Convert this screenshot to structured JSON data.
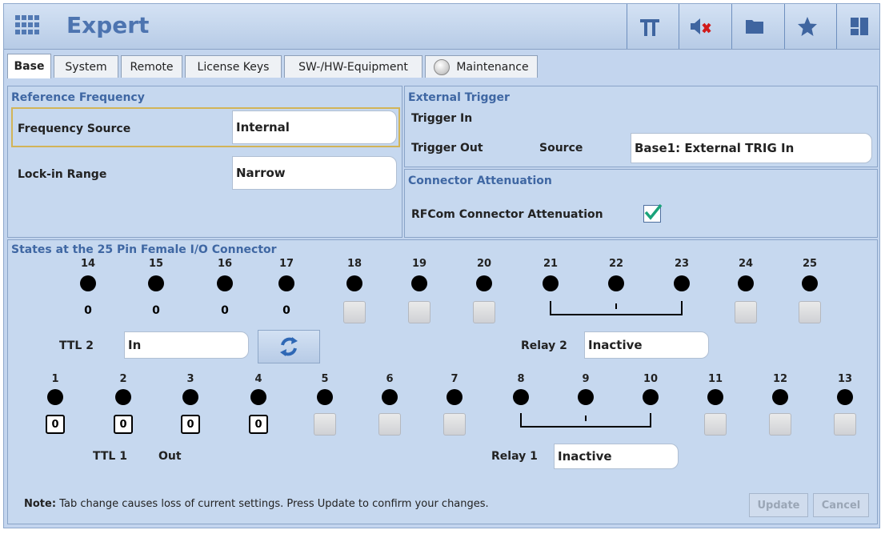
{
  "header": {
    "title": "Expert",
    "icons": [
      "apps-grid-icon",
      "pi-icon",
      "mute-icon",
      "folder-icon",
      "star-icon",
      "layout-icon"
    ]
  },
  "tabs": [
    {
      "label": "Base",
      "active": true
    },
    {
      "label": "System"
    },
    {
      "label": "Remote"
    },
    {
      "label": "License Keys"
    },
    {
      "label": "SW-/HW-Equipment"
    },
    {
      "label": "Maintenance",
      "icon": "status-led-icon"
    }
  ],
  "reference": {
    "title": "Reference Frequency",
    "freq_source_label": "Frequency Source",
    "freq_source_value": "Internal",
    "lockin_label": "Lock-in Range",
    "lockin_value": "Narrow"
  },
  "trigger": {
    "title": "External Trigger",
    "trigger_in_label": "Trigger In",
    "trigger_out_label": "Trigger Out",
    "source_label": "Source",
    "source_value": "Base1: External TRIG In"
  },
  "attenuation": {
    "title": "Connector Attenuation",
    "label": "RFCom Connector Attenuation",
    "checked": true
  },
  "connector": {
    "title": "States at the 25 Pin Female I/O Connector",
    "top_pins": [
      "14",
      "15",
      "16",
      "17",
      "18",
      "19",
      "20",
      "21",
      "22",
      "23",
      "24",
      "25"
    ],
    "top_values": [
      "0",
      "0",
      "0",
      "0"
    ],
    "bottom_pins": [
      "1",
      "2",
      "3",
      "4",
      "5",
      "6",
      "7",
      "8",
      "9",
      "10",
      "11",
      "12",
      "13"
    ],
    "bottom_values": [
      "0",
      "0",
      "0",
      "0"
    ],
    "ttl2_label": "TTL 2",
    "ttl2_value": "In",
    "ttl1_label": "TTL 1",
    "ttl1_value": "Out",
    "relay2_label": "Relay 2",
    "relay2_value": "Inactive",
    "relay1_label": "Relay 1",
    "relay1_value": "Inactive"
  },
  "footer": {
    "note_bold": "Note:",
    "note_text": "Tab change causes loss of current settings. Press Update to confirm your changes.",
    "update_label": "Update",
    "cancel_label": "Cancel"
  },
  "colors": {
    "accent": "#4d74b0",
    "panel": "#c6d8ef",
    "check": "#1aa37a",
    "mute_x": "#d11a1a"
  }
}
